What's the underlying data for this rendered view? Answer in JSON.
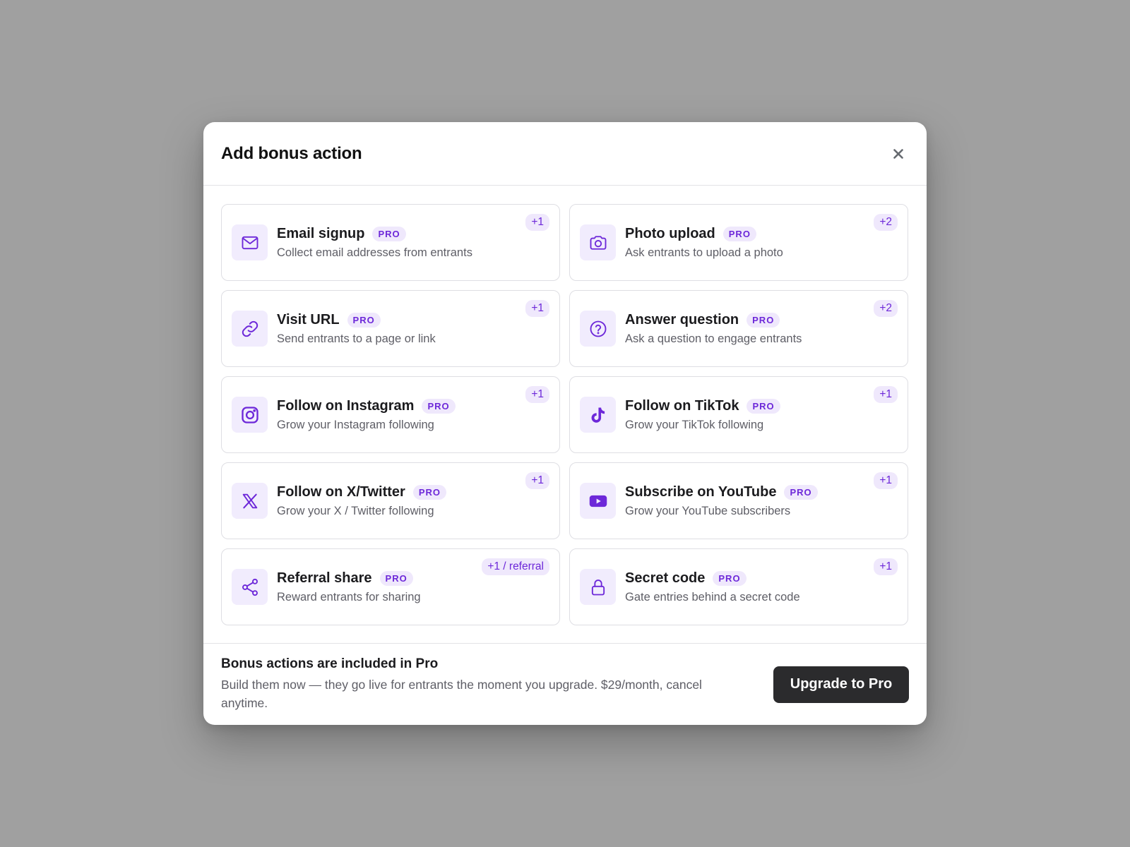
{
  "modal": {
    "title": "Add bonus action",
    "close_icon": "close-icon"
  },
  "colors": {
    "accent": "#6d28d9",
    "accent_bg": "#efe8fc",
    "backdrop": "#a0a0a0",
    "button_bg": "#2b2b2d"
  },
  "actions": [
    {
      "title": "Email signup",
      "badge": "PRO",
      "desc": "Collect email addresses from entrants",
      "points": "+1",
      "icon": "mail-icon"
    },
    {
      "title": "Photo upload",
      "badge": "PRO",
      "desc": "Ask entrants to upload a photo",
      "points": "+2",
      "icon": "camera-icon"
    },
    {
      "title": "Visit URL",
      "badge": "PRO",
      "desc": "Send entrants to a page or link",
      "points": "+1",
      "icon": "link-icon"
    },
    {
      "title": "Answer question",
      "badge": "PRO",
      "desc": "Ask a question to engage entrants",
      "points": "+2",
      "icon": "question-icon"
    },
    {
      "title": "Follow on Instagram",
      "badge": "PRO",
      "desc": "Grow your Instagram following",
      "points": "+1",
      "icon": "instagram-icon"
    },
    {
      "title": "Follow on TikTok",
      "badge": "PRO",
      "desc": "Grow your TikTok following",
      "points": "+1",
      "icon": "tiktok-icon"
    },
    {
      "title": "Follow on X/Twitter",
      "badge": "PRO",
      "desc": "Grow your X / Twitter following",
      "points": "+1",
      "icon": "x-twitter-icon"
    },
    {
      "title": "Subscribe on YouTube",
      "badge": "PRO",
      "desc": "Grow your YouTube subscribers",
      "points": "+1",
      "icon": "youtube-icon"
    },
    {
      "title": "Referral share",
      "badge": "PRO",
      "desc": "Reward entrants for sharing",
      "points": "+1 / referral",
      "icon": "share-icon"
    },
    {
      "title": "Secret code",
      "badge": "PRO",
      "desc": "Gate entries behind a secret code",
      "points": "+1",
      "icon": "lock-icon"
    }
  ],
  "footer": {
    "title": "Bonus actions are included in Pro",
    "desc": "Build them now — they go live for entrants the moment you upgrade. $29/month, cancel anytime.",
    "button_label": "Upgrade to Pro"
  }
}
